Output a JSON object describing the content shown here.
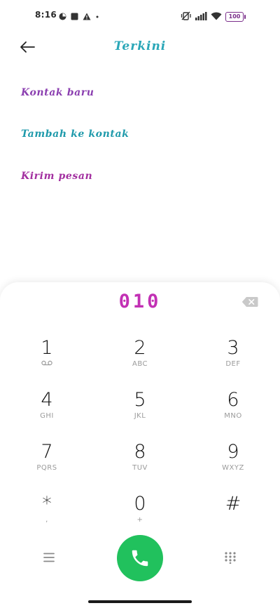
{
  "status_bar": {
    "time": "8:16",
    "battery": "100",
    "icons_left": [
      "data-saver-icon",
      "square-icon",
      "warning-icon",
      "dot-icon"
    ],
    "icons_right": [
      "vibrate-off-icon",
      "signal-icon",
      "wifi-icon",
      "battery-icon"
    ]
  },
  "header": {
    "title": "Terkini"
  },
  "options": [
    {
      "label": "Kontak baru"
    },
    {
      "label": "Tambah ke kontak"
    },
    {
      "label": "Kirim pesan"
    }
  ],
  "dialer": {
    "number": "010",
    "keys": [
      {
        "digit": "1",
        "letters": ""
      },
      {
        "digit": "2",
        "letters": "ABC"
      },
      {
        "digit": "3",
        "letters": "DEF"
      },
      {
        "digit": "4",
        "letters": "GHI"
      },
      {
        "digit": "5",
        "letters": "JKL"
      },
      {
        "digit": "6",
        "letters": "MNO"
      },
      {
        "digit": "7",
        "letters": "PQRS"
      },
      {
        "digit": "8",
        "letters": "TUV"
      },
      {
        "digit": "9",
        "letters": "WXYZ"
      },
      {
        "digit": "*",
        "letters": ","
      },
      {
        "digit": "0",
        "letters": "+"
      },
      {
        "digit": "#",
        "letters": ""
      }
    ]
  },
  "colors": {
    "accent_teal": "#2aa7b8",
    "accent_magenta": "#c230b4",
    "call_green": "#21c15d"
  }
}
